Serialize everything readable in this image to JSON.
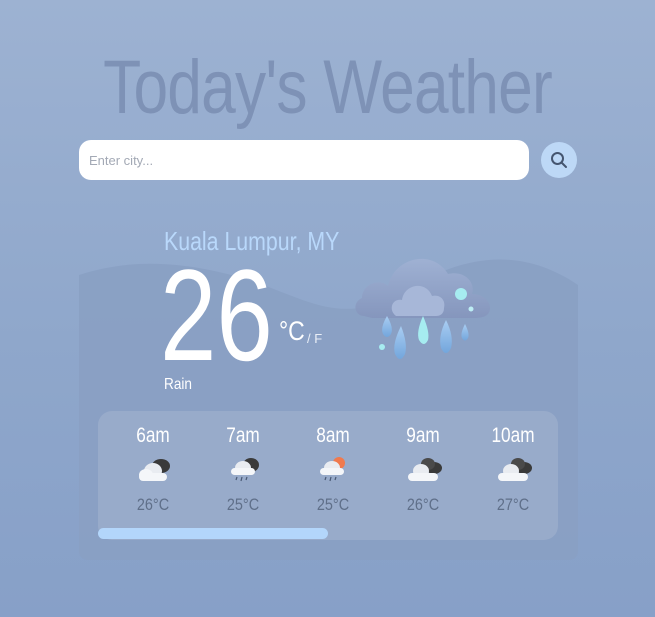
{
  "header": {
    "title": "Today's Weather"
  },
  "search": {
    "placeholder": "Enter city...",
    "value": ""
  },
  "current": {
    "location": "Kuala Lumpur, MY",
    "temperature": "26",
    "unit_celsius": "°C",
    "unit_fahrenheit": "/ F",
    "condition": "Rain",
    "icon": "rain-cloud-icon"
  },
  "hourly": [
    {
      "time": "6am",
      "temp": "26°C",
      "icon": "cloudy-icon"
    },
    {
      "time": "7am",
      "temp": "25°C",
      "icon": "cloud-rain-icon"
    },
    {
      "time": "8am",
      "temp": "25°C",
      "icon": "sun-cloud-rain-icon"
    },
    {
      "time": "9am",
      "temp": "26°C",
      "icon": "cloudy-icon"
    },
    {
      "time": "10am",
      "temp": "27°C",
      "icon": "cloudy-icon"
    }
  ],
  "scroll": {
    "position": 0.0,
    "visible_fraction": 0.5
  },
  "colors": {
    "accent": "#b9d8fb",
    "background": "#93aacb",
    "text": "#ffffff"
  }
}
